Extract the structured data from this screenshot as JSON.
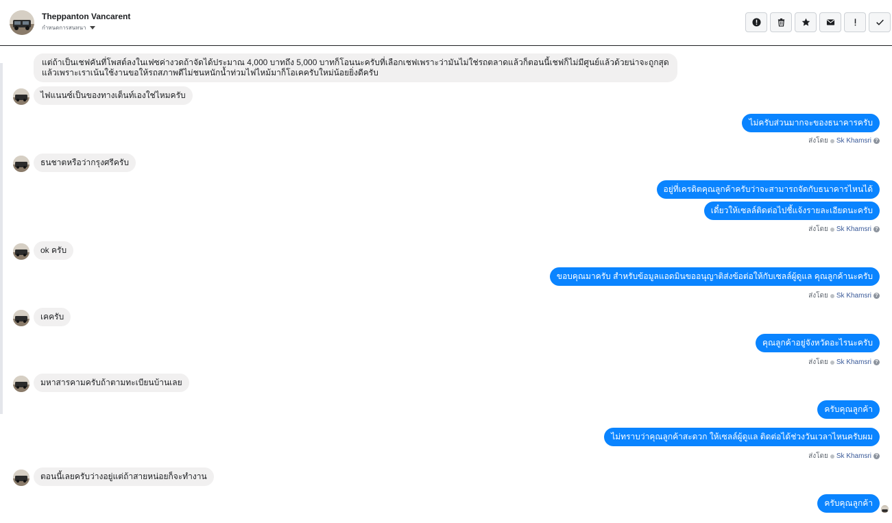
{
  "header": {
    "contact_name": "Theppanton Vancarent",
    "assign_label": "กำหนดการสนทนา",
    "actions": [
      {
        "name": "report-icon"
      },
      {
        "name": "trash-icon"
      },
      {
        "name": "star-icon"
      },
      {
        "name": "mail-icon"
      },
      {
        "name": "exclamation-icon"
      },
      {
        "name": "check-icon"
      }
    ]
  },
  "messages": [
    {
      "dir": "in",
      "avatar": false,
      "lines": [
        "แต่ถ้าเป็นเชฟคันที่โพสต์ลงในเฟซค่างวดถ้าจัดได้ประมาณ 4,000 บาทถึง 5,000 บาทก็โอนนะครับที่เลือกเชฟเพราะว่ามันไม่ใช่รถตลาดแล้วก็ตอนนี้เชฟก็ไม่มีศูนย์แล้วด้วยน่าจะถูกสุด",
        "แล้วเพราะเราเน้นใช้งานขอให้รถสภาพดีไม่ชนหนักน้ำท่วมไฟไหม้มาก็โอเคครับใหม่น้อยยิ่งดีครับ"
      ]
    },
    {
      "dir": "in",
      "avatar": true,
      "lines": [
        "ไฟแนนซ์เป็นของทางเต็นท์เองใช่ไหมครับ"
      ]
    },
    {
      "dir": "out",
      "lines": [
        "ไม่ครับส่วนมากจะของธนาคารครับ"
      ]
    },
    {
      "dir": "in",
      "avatar": true,
      "lines": [
        "ธนชาตหรือว่ากรุงศรีครับ"
      ]
    },
    {
      "dir": "out",
      "lines": [
        "อยู่ที่เครดิตคุณลูกค้าครับว่าจะสามารถจัดกับธนาคารไหนได้"
      ]
    },
    {
      "dir": "out",
      "lines": [
        "เดี๋ยวให้เซลล์ติดต่อไปชี้แจ้งรายละเอียดนะครับ"
      ]
    },
    {
      "dir": "in",
      "avatar": true,
      "lines": [
        "ok ครับ"
      ]
    },
    {
      "dir": "out",
      "lines": [
        "ขอบคุณมาครับ สำหรับข้อมูลแอดมินขออนุญาติส่งข้อต่อให้กับเซลล์ผู้ดูแล คุณลูกค้านะครับ"
      ]
    },
    {
      "dir": "in",
      "avatar": true,
      "lines": [
        "เคครับ"
      ]
    },
    {
      "dir": "out",
      "lines": [
        "คุณลูกค้าอยู่จังหวัดอะไรนะครับ"
      ]
    },
    {
      "dir": "in",
      "avatar": true,
      "lines": [
        "มหาสารคามครับถ้าตามทะเบียนบ้านเลย"
      ]
    },
    {
      "dir": "out",
      "lines": [
        "ครับคุณลูกค้า"
      ]
    },
    {
      "dir": "out",
      "lines": [
        "ไม่ทราบว่าคุณลูกค้าสะดวก ให้เซลล์ผู้ดูแล ติดต่อได้ช่วงวันเวลาไหนครับผม"
      ]
    },
    {
      "dir": "in",
      "avatar": true,
      "lines": [
        "ตอนนี้เลยครับว่างอยู่แต่ถ้าสายหน่อยก็จะทำงาน"
      ]
    },
    {
      "dir": "out",
      "lines": [
        "ครับคุณลูกค้า"
      ]
    }
  ],
  "sent_by": {
    "prefix": "ส่งโดย",
    "agent": "Sk Khamsri",
    "help": "?"
  },
  "colors": {
    "outgoing": "#0a84ff",
    "incoming": "#f1f0f0",
    "agent_link": "#385898"
  }
}
